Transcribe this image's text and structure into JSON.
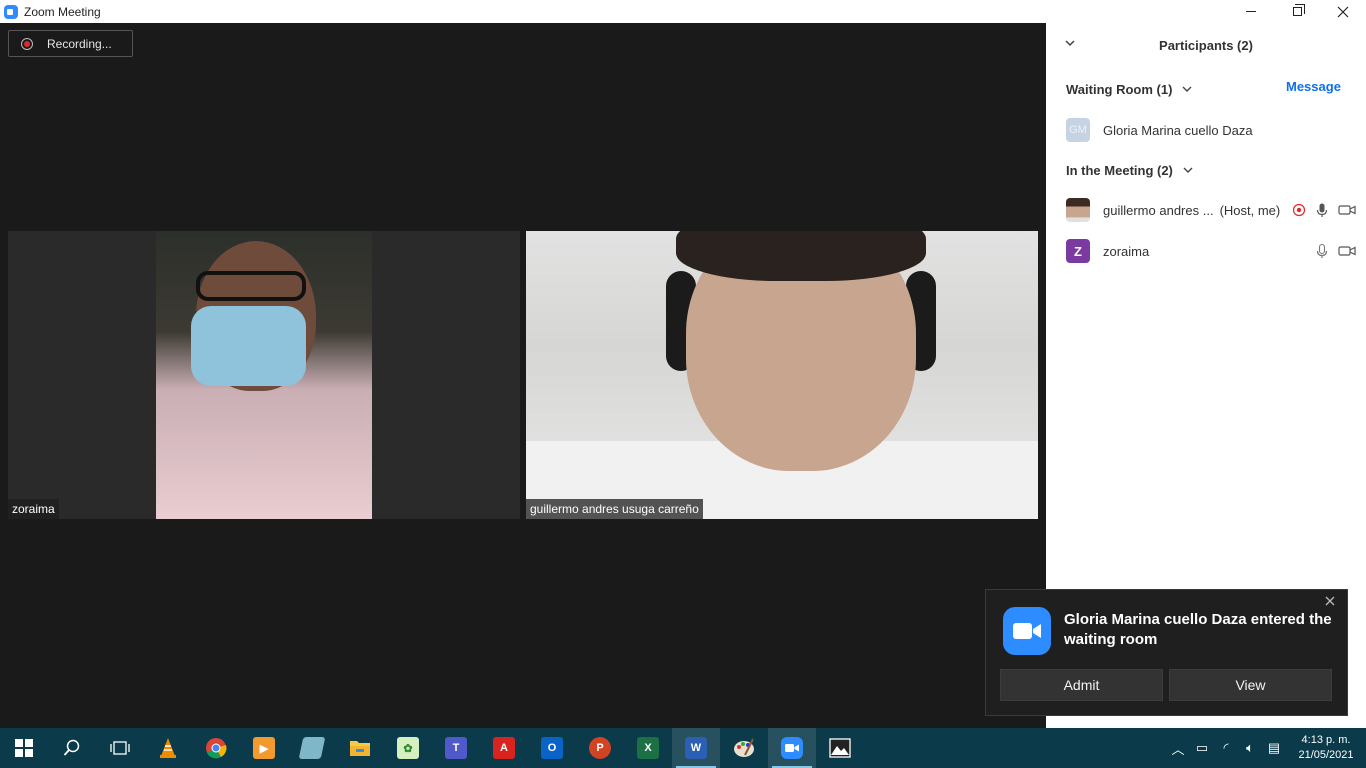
{
  "window": {
    "title": "Zoom Meeting"
  },
  "recording": {
    "label": "Recording..."
  },
  "videos": [
    {
      "name": "zoraima"
    },
    {
      "name": "guillermo andres usuga carreño"
    }
  ],
  "participants_panel": {
    "title": "Participants (2)",
    "waiting_room": {
      "label": "Waiting Room (1)",
      "message_label": "Message",
      "people": [
        {
          "initials": "GM",
          "name": "Gloria Marina cuello Daza"
        }
      ]
    },
    "in_meeting": {
      "label": "In the Meeting (2)",
      "people": [
        {
          "name": "guillermo andres ...",
          "suffix": "(Host, me)"
        },
        {
          "initials": "Z",
          "name": "zoraima"
        }
      ]
    }
  },
  "toast": {
    "message": "Gloria Marina cuello Daza entered the waiting room",
    "admit_label": "Admit",
    "view_label": "View"
  },
  "taskbar": {
    "apps": [
      "start",
      "search",
      "task-view",
      "vlc",
      "chrome",
      "media-player",
      "notes",
      "file-explorer",
      "app-green",
      "teams",
      "acrobat",
      "outlook",
      "powerpoint",
      "excel",
      "word",
      "paint",
      "zoom",
      "photos"
    ],
    "time": "4:13 p. m.",
    "date": "21/05/2021"
  },
  "colors": {
    "zoom_blue": "#2d8cff",
    "link_blue": "#0e71eb",
    "taskbar": "#0b3a4a",
    "recording_red": "#e02828"
  }
}
